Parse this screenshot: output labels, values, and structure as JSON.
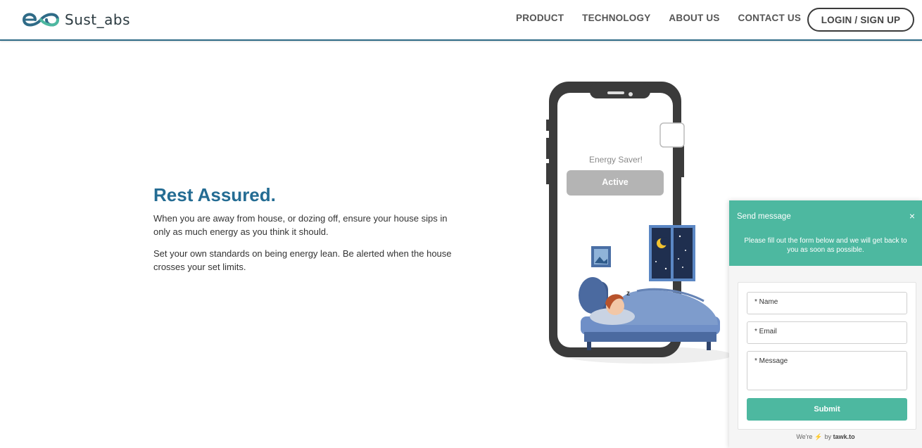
{
  "brand": {
    "name": "Sust_abs",
    "primary_color": "#246c93",
    "accent_color": "#4db8a0"
  },
  "nav": {
    "items": [
      "PRODUCT",
      "TECHNOLOGY",
      "ABOUT US",
      "CONTACT US"
    ],
    "login_label": "LOGIN / SIGN UP"
  },
  "hero": {
    "title": "Rest Assured.",
    "p1": "When you are away from house, or dozing off, ensure your house sips in only as much energy as you think it should.",
    "p2": "Set your own standards on being energy lean. Be alerted when the house crosses your set limits."
  },
  "illustration": {
    "screen_title": "Energy Saver!",
    "status_label": "Active",
    "sleep_mark": "z"
  },
  "chat": {
    "title": "Send message",
    "close_icon": "×",
    "subtitle": "Please fill out the form below and we will get back to you as soon as possible.",
    "name_placeholder": "* Name",
    "email_placeholder": "* Email",
    "message_placeholder": "* Message",
    "submit_label": "Submit",
    "footer_prefix": "We're",
    "footer_by": "by",
    "footer_brand": "tawk.to"
  }
}
